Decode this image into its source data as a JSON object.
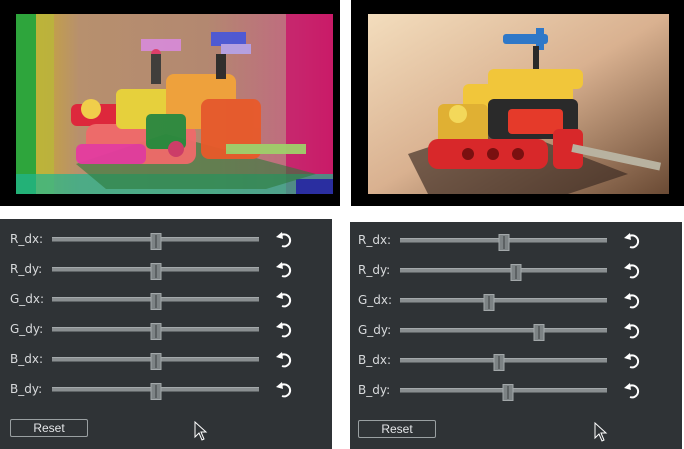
{
  "panels": [
    {
      "id": "left",
      "image_description": "shifted-color",
      "sliders": [
        {
          "label": "R_dx:",
          "value": 0.5
        },
        {
          "label": "R_dy:",
          "value": 0.5
        },
        {
          "label": "G_dx:",
          "value": 0.5
        },
        {
          "label": "G_dy:",
          "value": 0.5
        },
        {
          "label": "B_dx:",
          "value": 0.5
        },
        {
          "label": "B_dy:",
          "value": 0.5
        }
      ],
      "reset_label": "Reset"
    },
    {
      "id": "right",
      "image_description": "corrected",
      "sliders": [
        {
          "label": "R_dx:",
          "value": 0.5
        },
        {
          "label": "R_dy:",
          "value": 0.56
        },
        {
          "label": "G_dx:",
          "value": 0.43
        },
        {
          "label": "G_dy:",
          "value": 0.67
        },
        {
          "label": "B_dx:",
          "value": 0.48
        },
        {
          "label": "B_dy:",
          "value": 0.52
        }
      ],
      "reset_label": "Reset"
    }
  ],
  "colors": {
    "panel_bg": "#2f3336",
    "text": "#d8dadc",
    "track": "#8a8f91",
    "handle": "#7d8385"
  }
}
